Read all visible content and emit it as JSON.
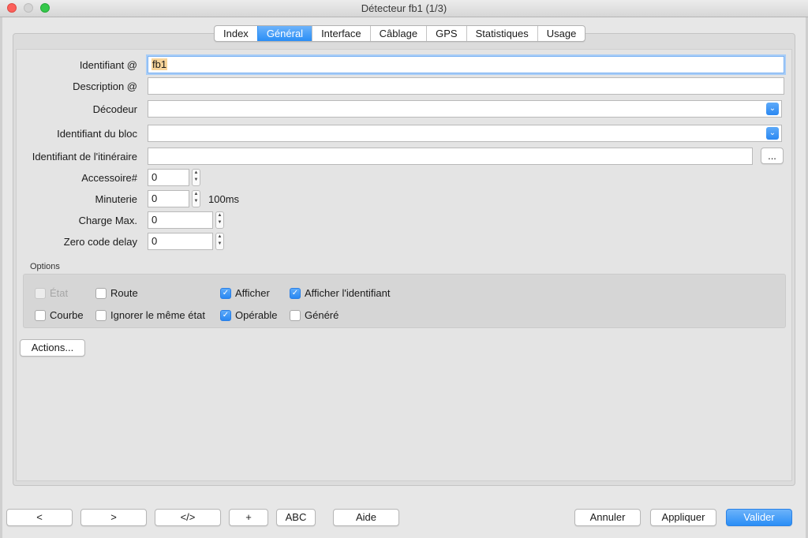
{
  "window": {
    "title": "Détecteur fb1 (1/3)"
  },
  "tabs": [
    "Index",
    "Général",
    "Interface",
    "Câblage",
    "GPS",
    "Statistiques",
    "Usage"
  ],
  "form": {
    "identifiant_label": "Identifiant @",
    "identifiant_value": "fb1",
    "description_label": "Description @",
    "description_value": "",
    "decodeur_label": "Décodeur",
    "decodeur_value": "",
    "bloc_label": "Identifiant du bloc",
    "bloc_value": "",
    "itineraire_label": "Identifiant de l'itinéraire",
    "itineraire_value": "",
    "itineraire_button": "...",
    "accessoire_label": "Accessoire#",
    "accessoire_value": "0",
    "minuterie_label": "Minuterie",
    "minuterie_value": "0",
    "minuterie_unit": "100ms",
    "charge_label": "Charge Max.",
    "charge_value": "0",
    "zero_label": "Zero code delay",
    "zero_value": "0"
  },
  "options": {
    "title": "Options",
    "etat": "État",
    "route": "Route",
    "afficher": "Afficher",
    "afficher_id": "Afficher l'identifiant",
    "courbe": "Courbe",
    "ignorer": "Ignorer le même état",
    "operable": "Opérable",
    "genere": "Généré"
  },
  "actions_label": "Actions...",
  "footer": {
    "prev": "<",
    "next": ">",
    "xml": "</>",
    "add": "+",
    "abc": "ABC",
    "aide": "Aide",
    "annuler": "Annuler",
    "appliquer": "Appliquer",
    "valider": "Valider"
  },
  "check_glyph": "✓",
  "arrow_glyph": "⌄",
  "spin_up": "▲",
  "spin_down": "▼",
  "colors": {
    "accent": "#2a8ef6",
    "focus_ring": "#a8cdf7",
    "selection": "#f7d49a"
  }
}
